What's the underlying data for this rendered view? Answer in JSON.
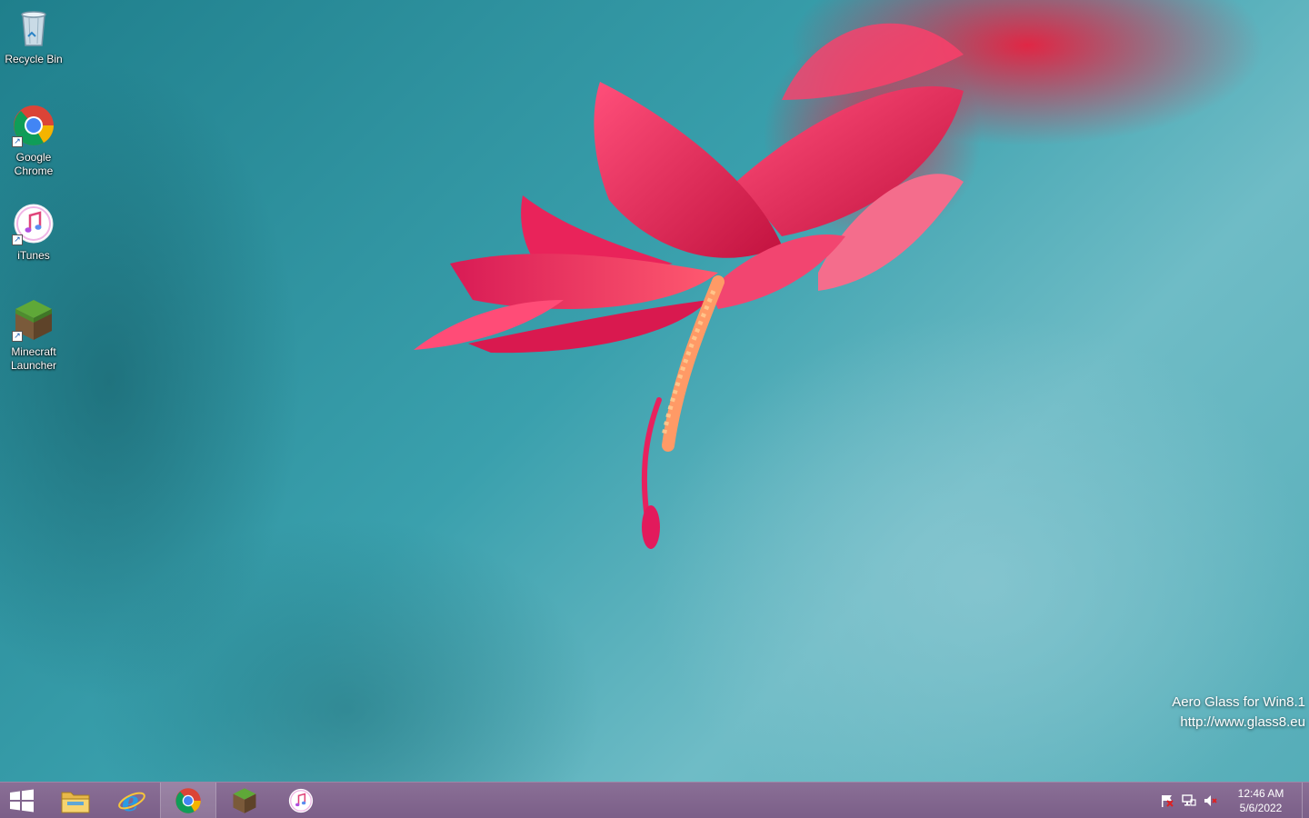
{
  "desktop": {
    "icons": [
      {
        "label": "Recycle Bin",
        "icon": "recycle-bin-icon",
        "shortcut": false
      },
      {
        "label": "Google Chrome",
        "icon": "chrome-icon",
        "shortcut": true
      },
      {
        "label": "iTunes",
        "icon": "itunes-icon",
        "shortcut": true
      },
      {
        "label": "Minecraft Launcher",
        "icon": "minecraft-icon",
        "shortcut": true
      }
    ],
    "watermark": {
      "line1": "Aero Glass for Win8.1",
      "line2": "http://www.glass8.eu"
    }
  },
  "taskbar": {
    "pinned": [
      {
        "icon": "file-explorer-icon"
      },
      {
        "icon": "internet-explorer-icon"
      },
      {
        "icon": "chrome-icon",
        "active": true
      },
      {
        "icon": "minecraft-icon"
      },
      {
        "icon": "itunes-icon"
      }
    ],
    "tray": {
      "icons": [
        "action-center-flag-icon",
        "network-icon",
        "volume-muted-icon"
      ],
      "time": "12:46 AM",
      "date": "5/6/2022"
    }
  },
  "colors": {
    "taskbar": "#7b5f88",
    "wallpaper_teal": "#3aa0ad",
    "flower": "#e0245e"
  }
}
